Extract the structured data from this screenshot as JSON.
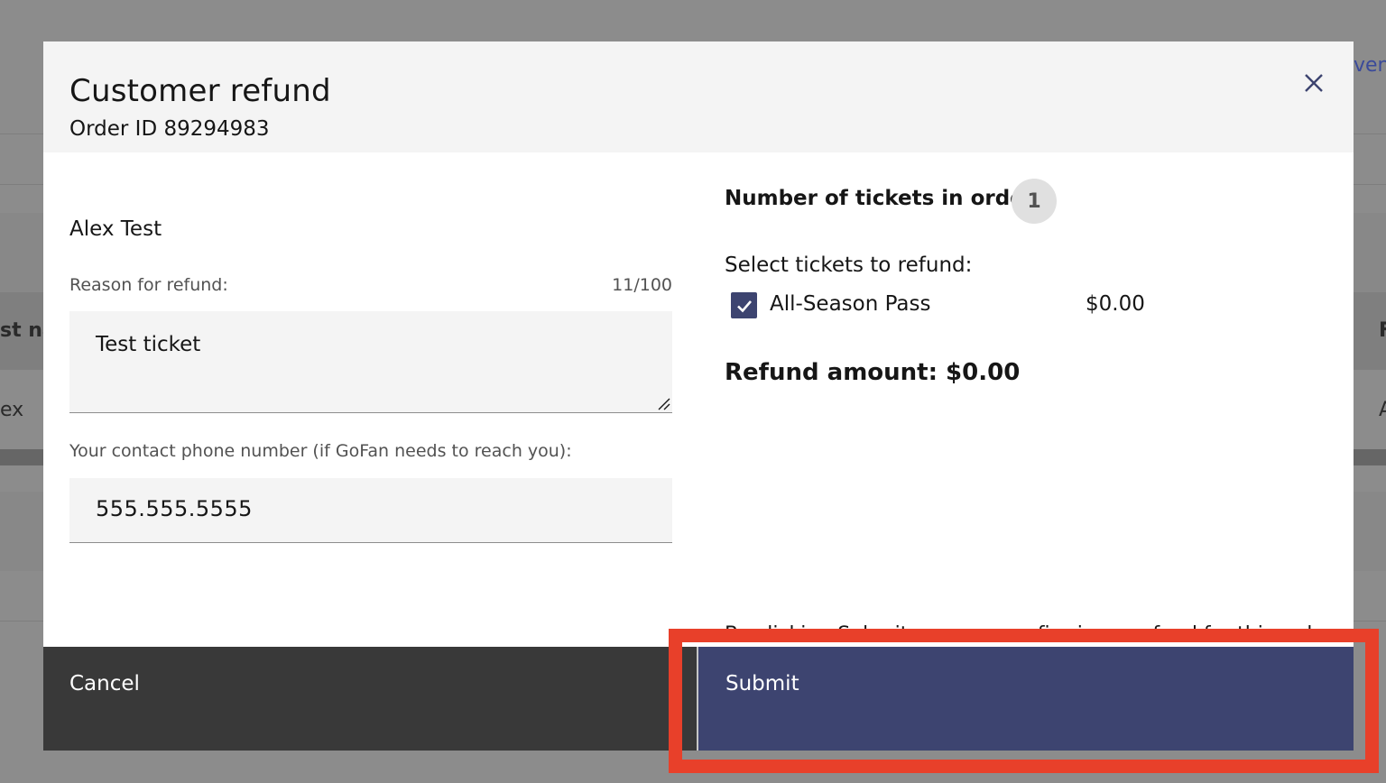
{
  "background": {
    "top_right_link": "ven",
    "table_header_left": "st na",
    "table_header_right": "F",
    "table_cell_left": "ex",
    "table_cell_right": "A"
  },
  "modal": {
    "title": "Customer refund",
    "subtitle": "Order ID 89294983",
    "close_label": "×"
  },
  "form": {
    "customer_name": "Alex Test",
    "reason_label": "Reason for refund:",
    "reason_counter": "11/100",
    "reason_value": "Test ticket",
    "phone_label": "Your contact phone number (if GoFan needs to reach you):",
    "phone_value": "555.555.5555"
  },
  "tickets": {
    "heading": "Number of tickets in order",
    "count": "1",
    "select_label": "Select tickets to refund:",
    "items": [
      {
        "name": "All-Season Pass",
        "price": "$0.00",
        "checked": true
      }
    ],
    "refund_amount": "Refund amount: $0.00",
    "disclaimer": "By clicking Submit, you are confirming a refund for this order"
  },
  "footer": {
    "cancel_label": "Cancel",
    "submit_label": "Submit"
  },
  "colors": {
    "primary": "#3d4470",
    "secondary_button": "#393939",
    "highlight": "#e8402a"
  }
}
